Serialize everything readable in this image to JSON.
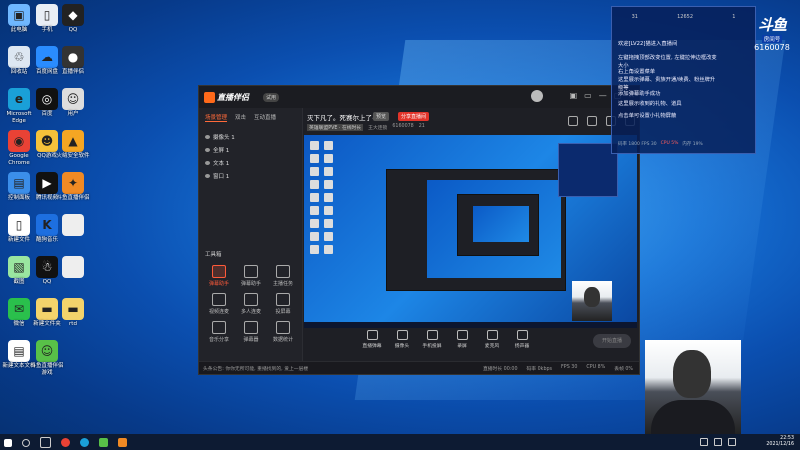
{
  "desktop_icons": [
    {
      "label": "此电脑",
      "color": "#6fb7ff",
      "glyph": "▣"
    },
    {
      "label": "手机",
      "color": "#e8eef5",
      "glyph": "▯"
    },
    {
      "label": "QQ",
      "color": "#222",
      "glyph": "◆"
    },
    {
      "label": "回收站",
      "color": "#dde7f2",
      "glyph": "♲"
    },
    {
      "label": "百度网盘",
      "color": "#2a8cff",
      "glyph": "☁"
    },
    {
      "label": "直播伴侣",
      "color": "#333",
      "glyph": "●"
    },
    {
      "label": "Microsoft Edge",
      "color": "#1aa0d8",
      "glyph": "e"
    },
    {
      "label": "百度",
      "color": "#111",
      "glyph": "◎"
    },
    {
      "label": "用户",
      "color": "#ddd",
      "glyph": "☺"
    },
    {
      "label": "Google Chrome",
      "color": "#e94235",
      "glyph": "◉"
    },
    {
      "label": "QQ游戏",
      "color": "#f6c23a",
      "glyph": "☻"
    },
    {
      "label": "火绒安全软件",
      "color": "#f5a623",
      "glyph": "▲"
    },
    {
      "label": "控制面板",
      "color": "#3b8eea",
      "glyph": "▤"
    },
    {
      "label": "腾讯视频",
      "color": "#111",
      "glyph": "▶"
    },
    {
      "label": "斗鱼直播伴侣",
      "color": "#f08a24",
      "glyph": "✦"
    },
    {
      "label": "新建文件",
      "color": "#fff",
      "glyph": "▯"
    },
    {
      "label": "酷狗音乐",
      "color": "#1d6fe0",
      "glyph": "K"
    },
    {
      "label": "",
      "color": "#eee",
      "glyph": ""
    },
    {
      "label": "截图",
      "color": "#9ae6a0",
      "glyph": "▧"
    },
    {
      "label": "QQ",
      "color": "#111",
      "glyph": "☃"
    },
    {
      "label": "",
      "color": "#eee",
      "glyph": ""
    },
    {
      "label": "微信",
      "color": "#2ac04c",
      "glyph": "✉"
    },
    {
      "label": "新建文件夹",
      "color": "#f3d36b",
      "glyph": "▬"
    },
    {
      "label": "rtd",
      "color": "#f3d36b",
      "glyph": "▬"
    },
    {
      "label": "新建文本文档",
      "color": "#fff",
      "glyph": "▤"
    },
    {
      "label": "斗鱼直播伴侣游戏",
      "color": "#58c048",
      "glyph": "☺"
    }
  ],
  "app": {
    "name": "直播伴侣",
    "badge": "试用",
    "window_controls": [
      "▣",
      "▭",
      "—",
      "▢",
      "✕"
    ],
    "left_tabs": [
      "场景管理",
      "双击",
      "互动直播"
    ],
    "sources": [
      "摄像头 1",
      "全屏 1",
      "文本 1",
      "窗口 1"
    ],
    "tools_title": "工具箱",
    "tools": [
      {
        "label": "弹幕助手",
        "hot": true
      },
      {
        "label": "弹幕助手",
        "hot": false
      },
      {
        "label": "主播任务",
        "hot": false
      },
      {
        "label": "视频连麦",
        "hot": false
      },
      {
        "label": "多人连麦",
        "hot": false
      },
      {
        "label": "投屏幕",
        "hot": false
      },
      {
        "label": "音乐分享",
        "hot": false
      },
      {
        "label": "弹幕器",
        "hot": false
      },
      {
        "label": "数据统计",
        "hot": false
      }
    ],
    "room_title": "灭下凡了。死赛尔上了~",
    "room_tag": "预览",
    "room_red": "分享直播间",
    "category": "英雄联盟PVE · 在线时长",
    "streamer": "王大连锁",
    "room_id": "6160078",
    "heat": "21",
    "controls": [
      "直播弹幕",
      "摄像头",
      "手机投屏",
      "录屏",
      "麦克风",
      "扬声器"
    ],
    "go_live": "开始直播",
    "status_notice": "头条公告: 你你无所可能, 重播找到的, 爱上一层楼",
    "stats": [
      "直播时长 00:00",
      "码率 0kbps",
      "FPS 30",
      "CPU 8%",
      "丢帧 0%"
    ]
  },
  "chat": {
    "top_stats": [
      "31",
      "12652",
      "1"
    ],
    "lines": [
      "欢迎[LV22]猫进入直播间",
      "左键拖拽顶部改变位置, 左键拉伸边框改变大小",
      "右上角设置菜单",
      "这里展示弹幕、贵族开通/续费、粉丝牌升级等",
      "添加弹幕助手成功",
      "这里展示收到的礼物、道具",
      "点击单可设置小礼物屏蔽"
    ],
    "bottom": [
      "码率 1800 FPS 30",
      "CPU 5%",
      "内存 19%"
    ]
  },
  "brand": {
    "logo": "斗鱼",
    "room_label": "房间号",
    "room_id": "6160078"
  },
  "taskbar": {
    "time": "22:53",
    "date": "2021/12/16"
  }
}
